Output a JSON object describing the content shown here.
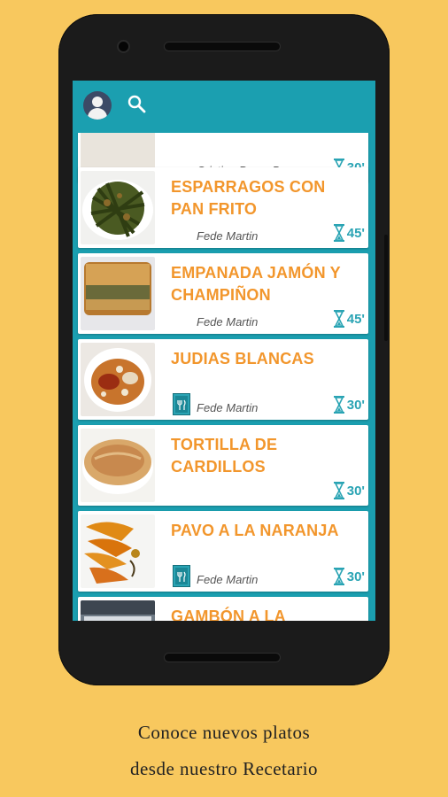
{
  "app": {
    "avatar_icon": "user-avatar-icon",
    "search_icon": "search-icon"
  },
  "recipes": [
    {
      "title": "",
      "author": "Cristina Perez Bayo",
      "time": "30'",
      "thumb": "plate-partial",
      "has_book": false
    },
    {
      "title": "ESPARRAGOS CON PAN FRITO",
      "author": "Fede Martin",
      "time": "45'",
      "thumb": "green-asparagus",
      "has_book": false
    },
    {
      "title": "EMPANADA JAMÓN Y CHAMPIÑON",
      "author": "Fede Martin",
      "time": "45'",
      "thumb": "empanada",
      "has_book": false
    },
    {
      "title": "JUDIAS BLANCAS",
      "author": "Fede Martin",
      "time": "30'",
      "thumb": "bean-stew",
      "has_book": true
    },
    {
      "title": "TORTILLA DE CARDILLOS",
      "author": "",
      "time": "30'",
      "thumb": "tortilla",
      "has_book": false
    },
    {
      "title": "PAVO A LA NARANJA",
      "author": "Fede Martin",
      "time": "30'",
      "thumb": "turkey-orange",
      "has_book": true
    },
    {
      "title": "GAMBÓN A LA PLANCHA",
      "author": "",
      "time": "",
      "thumb": "prawns",
      "has_book": false
    }
  ],
  "caption": {
    "line1": "Conoce nuevos platos",
    "line2": "desde nuestro Recetario"
  },
  "colors": {
    "background": "#F8C85E",
    "primary": "#1B9FB0",
    "title": "#F2962C",
    "timer": "#2aa4b4"
  }
}
